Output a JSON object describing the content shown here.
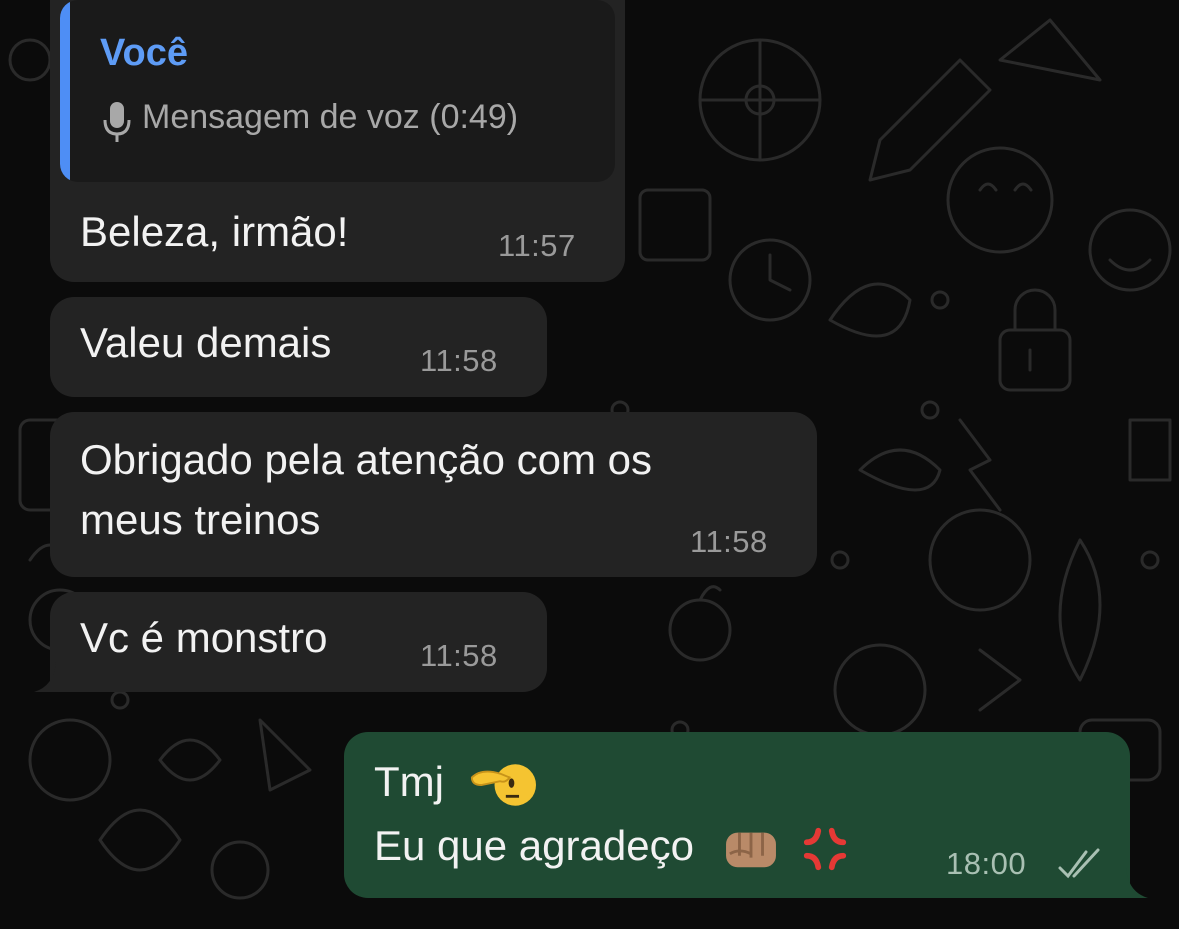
{
  "chat": {
    "messages": [
      {
        "direction": "incoming",
        "quote": {
          "author": "Você",
          "type_icon": "mic-icon",
          "text": "Mensagem de voz (0:49)"
        },
        "text": "Beleza, irmão!",
        "time": "11:57"
      },
      {
        "direction": "incoming",
        "text": "Valeu demais",
        "time": "11:58"
      },
      {
        "direction": "incoming",
        "lines": [
          "Obrigado pela atenção com os",
          "meus treinos"
        ],
        "time": "11:58"
      },
      {
        "direction": "incoming",
        "text": "Vc é monstro",
        "time": "11:58"
      },
      {
        "direction": "outgoing",
        "lines": [
          "Tmj",
          "Eu que agradeço"
        ],
        "emojis": [
          "saluting-face-emoji",
          "fist-medium-skin-emoji",
          "anger-symbol-emoji"
        ],
        "time": "18:00",
        "status_icon": "double-check-icon"
      }
    ]
  },
  "colors": {
    "background": "#0b0b0b",
    "incoming_bubble": "#232323",
    "outgoing_bubble": "#1f4a33",
    "quote_accent": "#4e8ef5",
    "quote_author": "#5e9cf6"
  }
}
